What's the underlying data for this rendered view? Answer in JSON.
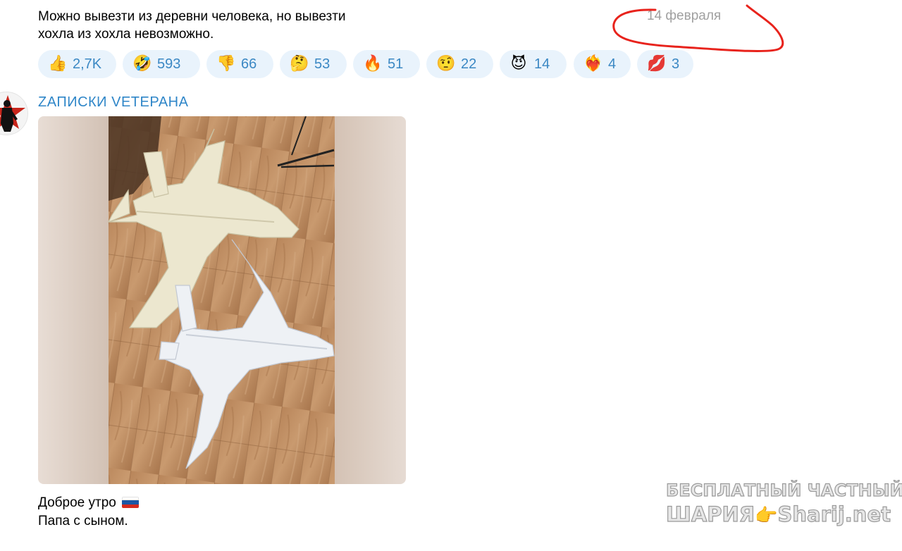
{
  "previous_message": {
    "lines": [
      "Можно вывезти из деревни человека, но вывезти",
      "хохла из хохла невозможно."
    ],
    "date": "14 февраля"
  },
  "reactions": [
    {
      "emoji": "👍",
      "icon": "thumbs-up-icon",
      "count": "2,7K"
    },
    {
      "emoji": "🤣",
      "icon": "rofl-icon",
      "count": "593"
    },
    {
      "emoji": "👎",
      "icon": "thumbs-down-icon",
      "count": "66"
    },
    {
      "emoji": "🤔",
      "icon": "thinking-face-icon",
      "count": "53"
    },
    {
      "emoji": "🔥",
      "icon": "fire-icon",
      "count": "51"
    },
    {
      "emoji": "🤨",
      "icon": "raised-eyebrow-icon",
      "count": "22"
    },
    {
      "emoji": "😈",
      "icon": "devil-icon",
      "count": "14"
    },
    {
      "emoji": "❤️‍🔥",
      "icon": "heart-on-fire-icon",
      "count": "4"
    },
    {
      "emoji": "💋",
      "icon": "kiss-mark-icon",
      "count": "3"
    }
  ],
  "message": {
    "sender": "ZАПИСКИ VЕТЕРАНА",
    "photo_icon": "model-aircraft-photo",
    "caption_lines": [
      "Доброе утро",
      "Папа с сыном."
    ],
    "caption_flag_icon": "russia-flag-icon"
  },
  "watermark": {
    "line1": "БЕСПЛАТНЫЙ ЧАСТНЫЙ",
    "line2_left": "ШАРИЯ",
    "line2_hand": "👉",
    "line2_right": "Sharij.net"
  },
  "colors": {
    "reaction_bg": "#e9f3fc",
    "reaction_count": "#3b88c4",
    "sender_name": "#2f86c8",
    "date_text": "#a0a0a0",
    "annotation_circle": "#e8231c",
    "flag": [
      "#ffffff",
      "#1c57a5",
      "#d52b1e"
    ]
  }
}
